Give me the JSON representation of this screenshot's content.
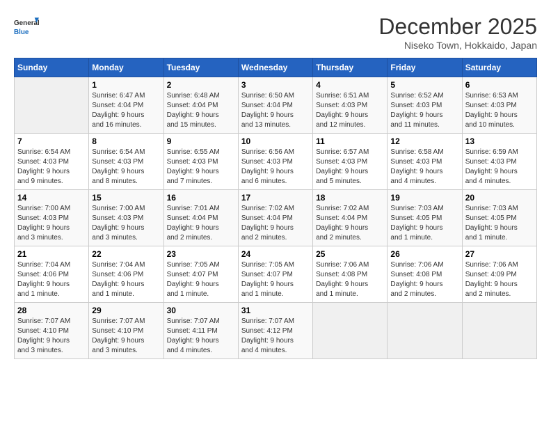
{
  "logo": {
    "line1": "General",
    "line2": "Blue"
  },
  "title": "December 2025",
  "location": "Niseko Town, Hokkaido, Japan",
  "days_of_week": [
    "Sunday",
    "Monday",
    "Tuesday",
    "Wednesday",
    "Thursday",
    "Friday",
    "Saturday"
  ],
  "weeks": [
    [
      {
        "num": "",
        "info": ""
      },
      {
        "num": "1",
        "info": "Sunrise: 6:47 AM\nSunset: 4:04 PM\nDaylight: 9 hours\nand 16 minutes."
      },
      {
        "num": "2",
        "info": "Sunrise: 6:48 AM\nSunset: 4:04 PM\nDaylight: 9 hours\nand 15 minutes."
      },
      {
        "num": "3",
        "info": "Sunrise: 6:50 AM\nSunset: 4:04 PM\nDaylight: 9 hours\nand 13 minutes."
      },
      {
        "num": "4",
        "info": "Sunrise: 6:51 AM\nSunset: 4:03 PM\nDaylight: 9 hours\nand 12 minutes."
      },
      {
        "num": "5",
        "info": "Sunrise: 6:52 AM\nSunset: 4:03 PM\nDaylight: 9 hours\nand 11 minutes."
      },
      {
        "num": "6",
        "info": "Sunrise: 6:53 AM\nSunset: 4:03 PM\nDaylight: 9 hours\nand 10 minutes."
      }
    ],
    [
      {
        "num": "7",
        "info": "Sunrise: 6:54 AM\nSunset: 4:03 PM\nDaylight: 9 hours\nand 9 minutes."
      },
      {
        "num": "8",
        "info": "Sunrise: 6:54 AM\nSunset: 4:03 PM\nDaylight: 9 hours\nand 8 minutes."
      },
      {
        "num": "9",
        "info": "Sunrise: 6:55 AM\nSunset: 4:03 PM\nDaylight: 9 hours\nand 7 minutes."
      },
      {
        "num": "10",
        "info": "Sunrise: 6:56 AM\nSunset: 4:03 PM\nDaylight: 9 hours\nand 6 minutes."
      },
      {
        "num": "11",
        "info": "Sunrise: 6:57 AM\nSunset: 4:03 PM\nDaylight: 9 hours\nand 5 minutes."
      },
      {
        "num": "12",
        "info": "Sunrise: 6:58 AM\nSunset: 4:03 PM\nDaylight: 9 hours\nand 4 minutes."
      },
      {
        "num": "13",
        "info": "Sunrise: 6:59 AM\nSunset: 4:03 PM\nDaylight: 9 hours\nand 4 minutes."
      }
    ],
    [
      {
        "num": "14",
        "info": "Sunrise: 7:00 AM\nSunset: 4:03 PM\nDaylight: 9 hours\nand 3 minutes."
      },
      {
        "num": "15",
        "info": "Sunrise: 7:00 AM\nSunset: 4:03 PM\nDaylight: 9 hours\nand 3 minutes."
      },
      {
        "num": "16",
        "info": "Sunrise: 7:01 AM\nSunset: 4:04 PM\nDaylight: 9 hours\nand 2 minutes."
      },
      {
        "num": "17",
        "info": "Sunrise: 7:02 AM\nSunset: 4:04 PM\nDaylight: 9 hours\nand 2 minutes."
      },
      {
        "num": "18",
        "info": "Sunrise: 7:02 AM\nSunset: 4:04 PM\nDaylight: 9 hours\nand 2 minutes."
      },
      {
        "num": "19",
        "info": "Sunrise: 7:03 AM\nSunset: 4:05 PM\nDaylight: 9 hours\nand 1 minute."
      },
      {
        "num": "20",
        "info": "Sunrise: 7:03 AM\nSunset: 4:05 PM\nDaylight: 9 hours\nand 1 minute."
      }
    ],
    [
      {
        "num": "21",
        "info": "Sunrise: 7:04 AM\nSunset: 4:06 PM\nDaylight: 9 hours\nand 1 minute."
      },
      {
        "num": "22",
        "info": "Sunrise: 7:04 AM\nSunset: 4:06 PM\nDaylight: 9 hours\nand 1 minute."
      },
      {
        "num": "23",
        "info": "Sunrise: 7:05 AM\nSunset: 4:07 PM\nDaylight: 9 hours\nand 1 minute."
      },
      {
        "num": "24",
        "info": "Sunrise: 7:05 AM\nSunset: 4:07 PM\nDaylight: 9 hours\nand 1 minute."
      },
      {
        "num": "25",
        "info": "Sunrise: 7:06 AM\nSunset: 4:08 PM\nDaylight: 9 hours\nand 1 minute."
      },
      {
        "num": "26",
        "info": "Sunrise: 7:06 AM\nSunset: 4:08 PM\nDaylight: 9 hours\nand 2 minutes."
      },
      {
        "num": "27",
        "info": "Sunrise: 7:06 AM\nSunset: 4:09 PM\nDaylight: 9 hours\nand 2 minutes."
      }
    ],
    [
      {
        "num": "28",
        "info": "Sunrise: 7:07 AM\nSunset: 4:10 PM\nDaylight: 9 hours\nand 3 minutes."
      },
      {
        "num": "29",
        "info": "Sunrise: 7:07 AM\nSunset: 4:10 PM\nDaylight: 9 hours\nand 3 minutes."
      },
      {
        "num": "30",
        "info": "Sunrise: 7:07 AM\nSunset: 4:11 PM\nDaylight: 9 hours\nand 4 minutes."
      },
      {
        "num": "31",
        "info": "Sunrise: 7:07 AM\nSunset: 4:12 PM\nDaylight: 9 hours\nand 4 minutes."
      },
      {
        "num": "",
        "info": ""
      },
      {
        "num": "",
        "info": ""
      },
      {
        "num": "",
        "info": ""
      }
    ]
  ]
}
